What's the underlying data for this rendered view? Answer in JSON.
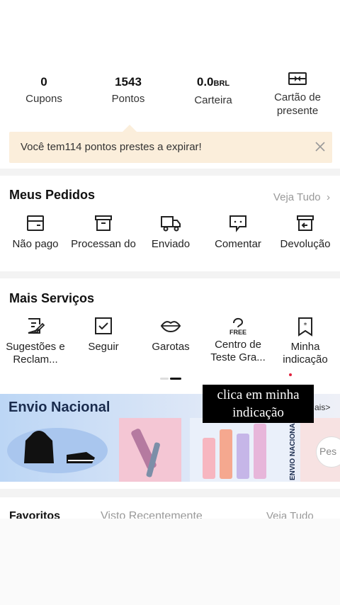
{
  "stats": [
    {
      "value": "0",
      "unit": "",
      "label": "Cupons"
    },
    {
      "value": "1543",
      "unit": "",
      "label": "Pontos"
    },
    {
      "value": "0.0",
      "unit": "BRL",
      "label": "Carteira"
    },
    {
      "value": "",
      "unit": "",
      "label": "Cartão de presente"
    }
  ],
  "expire_banner": {
    "text": "Você tem114  pontos prestes a expirar!"
  },
  "orders": {
    "title": "Meus Pedidos",
    "see_all": "Veja Tudo",
    "items": [
      {
        "label": "Não pago",
        "icon": "wallet-card-icon"
      },
      {
        "label": "Processan do",
        "icon": "box-icon"
      },
      {
        "label": "Enviado",
        "icon": "truck-icon"
      },
      {
        "label": "Comentar",
        "icon": "comment-icon"
      },
      {
        "label": "Devolução",
        "icon": "return-box-icon"
      }
    ]
  },
  "services": {
    "title": "Mais Serviços",
    "items": [
      {
        "label": "Sugestões e Reclam...",
        "icon": "feedback-edit-icon"
      },
      {
        "label": "Seguir",
        "icon": "checkbox-icon"
      },
      {
        "label": "Garotas",
        "icon": "lips-icon"
      },
      {
        "label": "Centro de Teste Gra...",
        "icon": "free-trial-icon"
      },
      {
        "label": "Minha indicação",
        "icon": "bookmark-star-icon"
      }
    ]
  },
  "promo": {
    "title": "Envio Nacional",
    "side_text": "ENVIO NACIONAL",
    "corner_text": "ais>",
    "tag": "Pes"
  },
  "caption": {
    "line1": "clica em minha",
    "line2": "indicação"
  },
  "favorites": {
    "tab1": "Favoritos",
    "tab2": "Visto Recentemente",
    "see_all": "Veja Tudo"
  },
  "colors": {
    "banner_bg": "#fbeedb",
    "accent_red": "#e0223e",
    "gray_text": "#999999"
  }
}
